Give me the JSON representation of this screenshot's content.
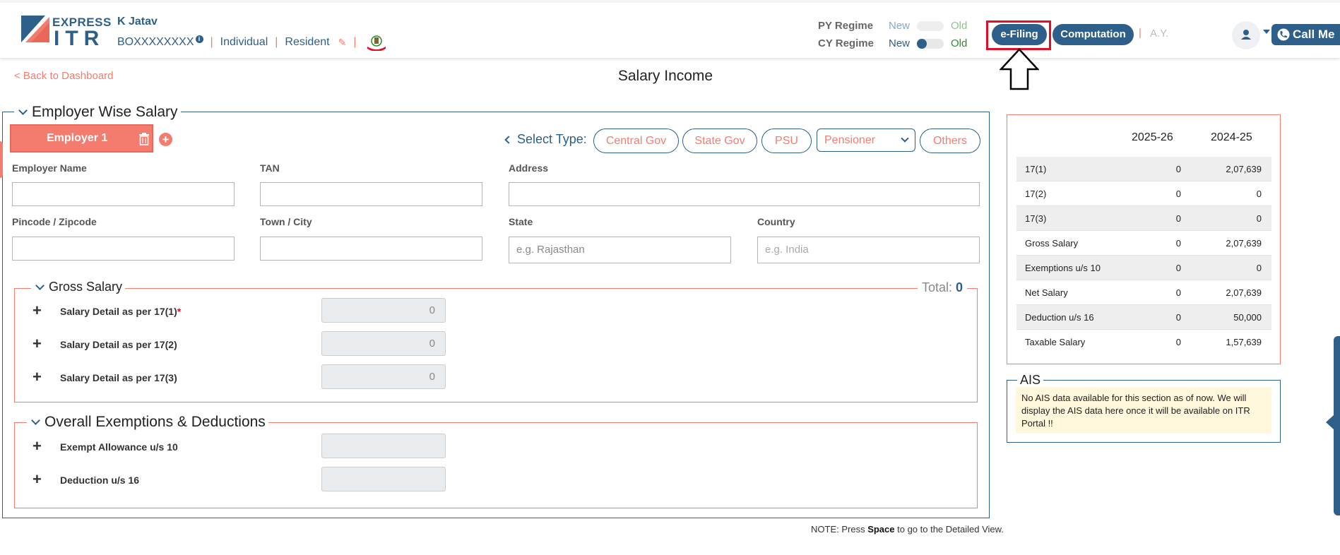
{
  "header": {
    "logo_express": "EXPRESS",
    "logo_itr": "ITR",
    "user_name": "K Jatav",
    "pan": "BOXXXXXXXX",
    "info": "i",
    "sep": "|",
    "status": "Individual",
    "residency": "Resident",
    "py_regime_label": "PY Regime",
    "cy_regime_label": "CY Regime",
    "new_label": "New",
    "old_label": "Old",
    "efiling_label": "e-Filing",
    "computation_label": "Computation",
    "ay_label": "A.Y.",
    "call_label": "Call Me"
  },
  "page": {
    "back_label": "< Back to Dashboard",
    "title": "Salary Income",
    "note_prefix": "NOTE: Press ",
    "note_key": "Space",
    "note_suffix": " to go to the Detailed View."
  },
  "employer": {
    "section_title": "Employer Wise Salary",
    "tab_label": "Employer 1",
    "add": "+",
    "select_type_label": "Select Type:",
    "types": [
      "Central Gov",
      "State Gov",
      "PSU",
      "Others"
    ],
    "selected_option": "Pensioner",
    "fields": {
      "employer_name": "Employer Name",
      "tan": "TAN",
      "address": "Address",
      "pincode": "Pincode / Zipcode",
      "town": "Town / City",
      "state": "State",
      "state_placeholder": "e.g. Rajasthan",
      "country": "Country",
      "country_placeholder": "e.g. India"
    }
  },
  "gross_salary": {
    "title": "Gross Salary",
    "total_label": "Total:",
    "total_value": "0",
    "rows": [
      {
        "label": "Salary Detail as per 17(1)",
        "required": "*",
        "value": "0"
      },
      {
        "label": "Salary Detail as per 17(2)",
        "value": "0"
      },
      {
        "label": "Salary Detail as per 17(3)",
        "value": "0"
      }
    ]
  },
  "exemptions": {
    "title": "Overall Exemptions & Deductions",
    "rows": [
      {
        "label": "Exempt Allowance u/s 10",
        "value": ""
      },
      {
        "label": "Deduction u/s 16",
        "value": ""
      }
    ]
  },
  "summary": {
    "col1": "2025-26",
    "col2": "2024-25",
    "rows": [
      {
        "label": "17(1)",
        "v1": "0",
        "v2": "2,07,639"
      },
      {
        "label": "17(2)",
        "v1": "0",
        "v2": "0"
      },
      {
        "label": "17(3)",
        "v1": "0",
        "v2": "0"
      },
      {
        "label": "Gross Salary",
        "v1": "0",
        "v2": "2,07,639"
      },
      {
        "label": "Exemptions u/s 10",
        "v1": "0",
        "v2": "0"
      },
      {
        "label": "Net Salary",
        "v1": "0",
        "v2": "2,07,639"
      },
      {
        "label": "Deduction u/s 16",
        "v1": "0",
        "v2": "50,000"
      },
      {
        "label": "Taxable Salary",
        "v1": "0",
        "v2": "1,57,639"
      }
    ]
  },
  "ais": {
    "title": "AIS",
    "message": "No AIS data available for this section as of now. We will display the AIS data here once it will be available on ITR Portal !!"
  },
  "colors": {
    "brand": "#2d5f8a",
    "accent": "#f47c6e",
    "highlight": "#e0102a"
  }
}
